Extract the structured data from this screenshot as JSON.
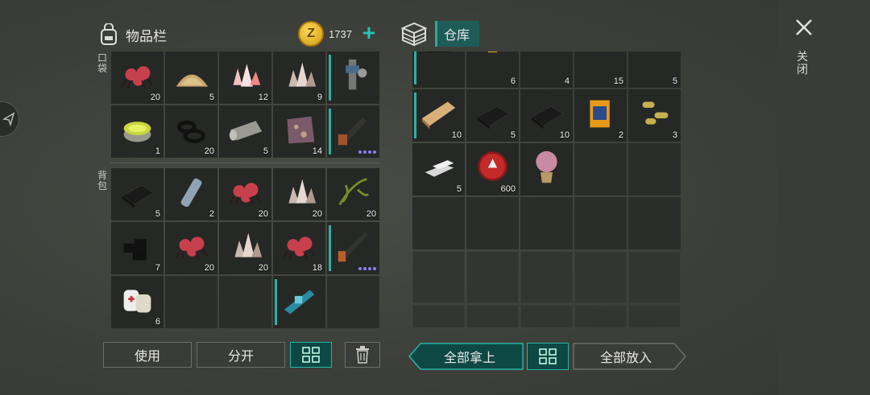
{
  "inventory": {
    "title": "物品栏",
    "icon": "backpack-icon",
    "pockets_label": "口袋",
    "backpack_label": "背包",
    "coins": {
      "symbol": "Z",
      "amount": "1737",
      "add_icon": "plus-icon"
    },
    "pockets": [
      {
        "item": "red-spider-glands",
        "count": "20"
      },
      {
        "item": "sand-pile",
        "count": "5"
      },
      {
        "item": "pink-crystal",
        "count": "12"
      },
      {
        "item": "quartz-crystal",
        "count": "9"
      },
      {
        "item": "chainsaw-weapon",
        "count": "",
        "equipped": true
      },
      {
        "item": "jar-of-slime",
        "count": "1"
      },
      {
        "item": "rubber-rings",
        "count": "20"
      },
      {
        "item": "cloth-roll",
        "count": "5"
      },
      {
        "item": "animal-hide",
        "count": "14"
      },
      {
        "item": "shotgun-weapon",
        "count": "",
        "equipped": true,
        "dots": 4
      }
    ],
    "backpack": [
      {
        "item": "black-fabric",
        "count": "5"
      },
      {
        "item": "plastic-bottle",
        "count": "2"
      },
      {
        "item": "red-spider-glands",
        "count": "20"
      },
      {
        "item": "quartz-crystal",
        "count": "20"
      },
      {
        "item": "green-herb",
        "count": "20"
      },
      {
        "item": "coal",
        "count": "7"
      },
      {
        "item": "red-spider-glands",
        "count": "20"
      },
      {
        "item": "quartz-crystal",
        "count": "20"
      },
      {
        "item": "red-spider-glands",
        "count": "18"
      },
      {
        "item": "rifle-weapon",
        "count": "",
        "equipped": true,
        "dots": 4
      },
      {
        "item": "bandage",
        "count": "6"
      },
      {
        "item": "",
        "count": ""
      },
      {
        "item": "",
        "count": ""
      },
      {
        "item": "laser-gun-weapon",
        "count": "",
        "equipped": true
      },
      {
        "item": "",
        "count": ""
      }
    ]
  },
  "warehouse": {
    "title": "仓库",
    "icon": "storage-box-icon",
    "slots": [
      {
        "item": "leather-jacket",
        "count": "",
        "equipped": true
      },
      {
        "item": "bullets",
        "count": "6"
      },
      {
        "item": "pills",
        "count": "4"
      },
      {
        "item": "metal-plate",
        "count": "15"
      },
      {
        "item": "steel-ingot",
        "count": "5"
      },
      {
        "item": "wooden-plank",
        "count": "10",
        "equipped": true
      },
      {
        "item": "black-fabric",
        "count": "5"
      },
      {
        "item": "black-fabric",
        "count": "10"
      },
      {
        "item": "dog-food",
        "count": "2"
      },
      {
        "item": "dog-biscuits",
        "count": "3"
      },
      {
        "item": "silver-ingots",
        "count": "5"
      },
      {
        "item": "bottle-cap",
        "count": "600"
      },
      {
        "item": "potted-flower",
        "count": ""
      },
      {
        "item": "",
        "count": ""
      },
      {
        "item": "",
        "count": ""
      }
    ]
  },
  "side": {
    "close_label": "关闭",
    "close_icon": "close-icon"
  },
  "buttons": {
    "use": "使用",
    "split": "分开",
    "sort_icon": "sort-grid-icon",
    "trash_icon": "trash-icon",
    "take_all": "全部拿上",
    "put_all": "全部放入"
  },
  "colors": {
    "accent": "#28b3a4",
    "slot": "#262825",
    "coin": "#e8b21f"
  }
}
